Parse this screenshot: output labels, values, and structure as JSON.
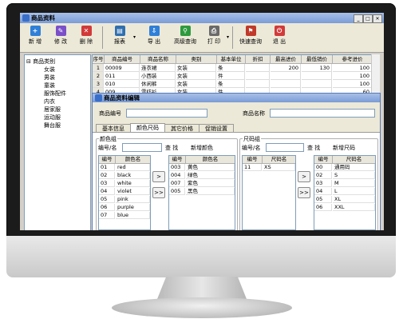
{
  "main_window": {
    "title": "商品资料"
  },
  "toolbar": [
    {
      "label": "新 增",
      "icon": "add-icon",
      "color": "#2f7fd8",
      "glyph": "+"
    },
    {
      "label": "修 改",
      "icon": "edit-icon",
      "color": "#7b4fc9",
      "glyph": "✎"
    },
    {
      "label": "删 除",
      "icon": "delete-icon",
      "color": "#d23a3a",
      "glyph": "✕"
    },
    {
      "label": "报表",
      "icon": "report-icon",
      "color": "#2f6fb0",
      "glyph": "▤"
    },
    {
      "label": "导 出",
      "icon": "export-icon",
      "color": "#2f7fd8",
      "glyph": "⇩"
    },
    {
      "label": "高级查询",
      "icon": "search-icon",
      "color": "#2e9a3e",
      "glyph": "⚲"
    },
    {
      "label": "打 印",
      "icon": "print-icon",
      "color": "#6a6a6a",
      "glyph": "⎙"
    },
    {
      "label": "快速查询",
      "icon": "quick-search-icon",
      "color": "#c0392b",
      "glyph": "⚑"
    },
    {
      "label": "退 出",
      "icon": "exit-icon",
      "color": "#d23a3a",
      "glyph": "⏻"
    }
  ],
  "tree": {
    "root": "商品类别",
    "items": [
      "女装",
      "男装",
      "童装",
      "服饰配件",
      "内衣",
      "居家服",
      "运动服",
      "舞台服"
    ]
  },
  "grid": {
    "columns": [
      "序号",
      "商品编号",
      "商品名称",
      "类别",
      "基本单位",
      "折扣",
      "最高进价",
      "最低销价",
      "参考进价"
    ],
    "rows": [
      [
        "1",
        "00009",
        "连衣裙",
        "女装",
        "条",
        "",
        "200",
        "130",
        "100"
      ],
      [
        "2",
        "011",
        "小西装",
        "女装",
        "件",
        "",
        "",
        "",
        "100"
      ],
      [
        "3",
        "010",
        "休闲裤",
        "女装",
        "条",
        "",
        "",
        "",
        "100"
      ],
      [
        "4",
        "009",
        "雪纺衫",
        "女装",
        "件",
        "",
        "",
        "",
        "60"
      ]
    ]
  },
  "edit_window": {
    "title": "商品资料编辑",
    "code_label": "商品编号",
    "name_label": "商品名称",
    "tabs": [
      "基本信息",
      "颜色尺码",
      "其它价格",
      "促销设置"
    ],
    "active_tab": 1
  },
  "color_group": {
    "title": "颜色组",
    "search_label": "编号/名",
    "find_label": "查 找",
    "new_label": "新增颜色",
    "list_headers": [
      "编号",
      "颜色名"
    ],
    "list": [
      [
        "01",
        "red"
      ],
      [
        "02",
        "black"
      ],
      [
        "03",
        "white"
      ],
      [
        "04",
        "violet"
      ],
      [
        "05",
        "pink"
      ],
      [
        "06",
        "purple"
      ],
      [
        "07",
        "blue"
      ]
    ],
    "selected_headers": [
      "编号",
      "颜色名"
    ],
    "selected": [
      [
        "003",
        "黄色"
      ],
      [
        "004",
        "绿色"
      ],
      [
        "007",
        "紫色"
      ],
      [
        "005",
        "黑色"
      ]
    ],
    "move_one": ">",
    "move_all": ">>"
  },
  "size_group": {
    "title": "尺码组",
    "search_label": "编号/名",
    "find_label": "查 找",
    "new_label": "新增尺码",
    "list_headers": [
      "编号",
      "尺码名"
    ],
    "list": [
      [
        "11",
        "XS"
      ]
    ],
    "selected_headers": [
      "编号",
      "尺码名"
    ],
    "selected": [
      [
        "00",
        "通用码"
      ],
      [
        "02",
        "S"
      ],
      [
        "03",
        "M"
      ],
      [
        "04",
        "L"
      ],
      [
        "05",
        "XL"
      ],
      [
        "06",
        "XXL"
      ]
    ],
    "move_one": ">",
    "move_all": ">>"
  }
}
